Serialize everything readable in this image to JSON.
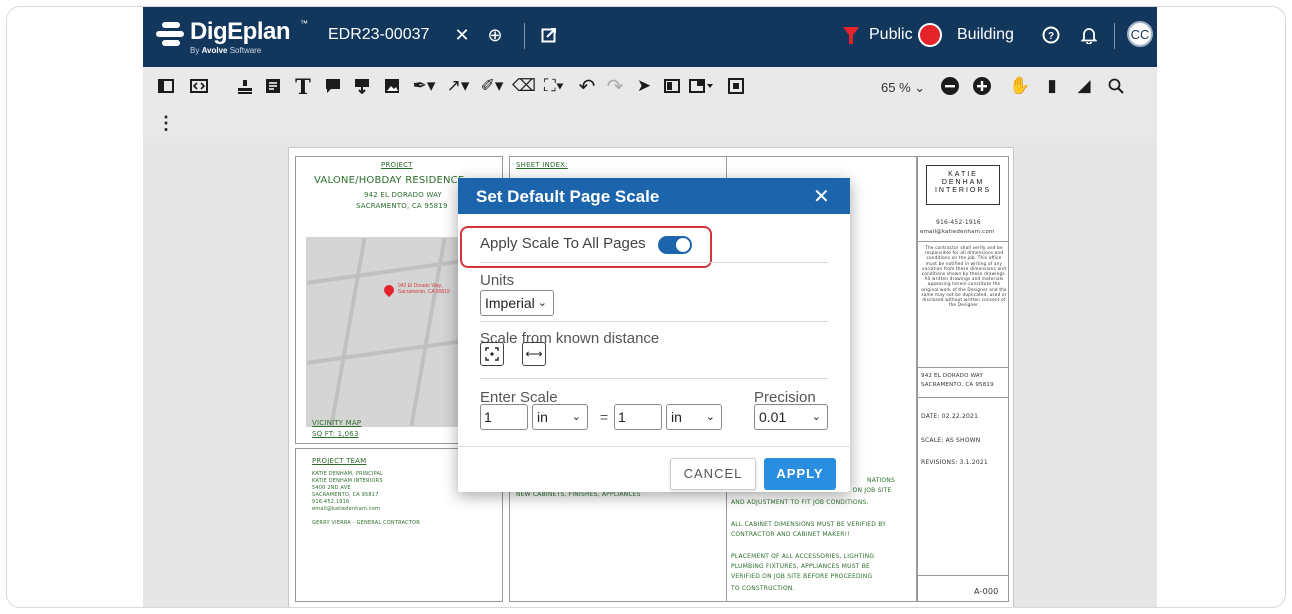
{
  "app": {
    "logo_name": "DigEplan",
    "logo_tm": "™",
    "logo_sub_prefix": "By ",
    "logo_sub_brand": "Avolve",
    "logo_sub_suffix": " Software",
    "document_id": "EDR23-00037",
    "public_label": "Public",
    "building_label": "Building",
    "avatar_initials": "CC",
    "zoom_level": "65 %",
    "accent_color": "#12365c"
  },
  "sheet": {
    "project_header": "PROJECT",
    "project_name": "VALONE/HOBDAY RESIDENCE",
    "address_line1": "942 EL DORADO WAY",
    "address_line2": "SACRAMENTO, CA 95819",
    "map_pin_label": "942 El Dorado Way, Sacramento, CA 95819",
    "vicinity_map": "VICINITY MAP",
    "sq_ft": "SQ FT: 1,063",
    "sheet_index": "SHEET INDEX:",
    "project_team": "PROJECT TEAM",
    "team_lines": [
      "KATIE DENHAM, PRINCIPAL",
      "KATIE DENHAM INTERIORS",
      "5400 2ND AVE",
      "SACRAMENTO, CA 95817",
      "916.452.1916",
      "email@katiedenham.com",
      "",
      "GERRY VIERRA - GENERAL CONTRACTOR"
    ],
    "new_cabinets": "NEW CABINETS, FINISHES, APPLIANCES",
    "notes": [
      "NATIONS",
      "TION ON JOB SITE",
      "AND ADJUSTMENT TO FIT JOB CONDITIONS.",
      "ALL CABINET DIMENSIONS MUST BE VERIFIED BY",
      "CONTRACTOR AND CABINET MAKER!!",
      "PLACEMENT OF ALL ACCESSORIES, LIGHTING",
      "PLUMBING FIXTURES, APPLIANCES MUST BE",
      "VERIFIED ON JOB SITE BEFORE PROCEEDING",
      "TO CONSTRUCTION."
    ],
    "tb_logo": "KATIE DENHAM INTERIORS",
    "tb_phone": "916-452-1916",
    "tb_email": "email@katiedenham.com",
    "tb_disclaimer": "The contractor shall verify and be responsible for all dimensions and conditions on the job. This office must be notified in writing of any variation from these dimensions and conditions shown by these drawings. All written drawings and materials appearing herein constitute the original work of the Designer and the same may not be duplicated, used or disclosed without written consent of the Designer.",
    "tb_address1": "942 EL DORADO WAY",
    "tb_address2": "SACRAMENTO, CA 95819",
    "tb_date": "DATE: 02.22.2021",
    "tb_scale": "SCALE: AS SHOWN",
    "tb_revisions": "REVISIONS: 3.1.2021",
    "tb_sheet": "A-000"
  },
  "dialog": {
    "title": "Set Default Page Scale",
    "close_symbol": "✕",
    "apply_all_label": "Apply Scale To All Pages",
    "apply_all_enabled": true,
    "units_label": "Units",
    "units_value": "Imperial",
    "scale_known_label": "Scale from known distance",
    "enter_scale_label": "Enter Scale",
    "precision_label": "Precision",
    "scale_left_value": "1",
    "scale_left_unit": "in",
    "equals": "=",
    "scale_right_value": "1",
    "scale_right_unit": "in",
    "precision_value": "0.01",
    "cancel_label": "CANCEL",
    "apply_label": "APPLY",
    "highlight_color": "#d4343a"
  }
}
